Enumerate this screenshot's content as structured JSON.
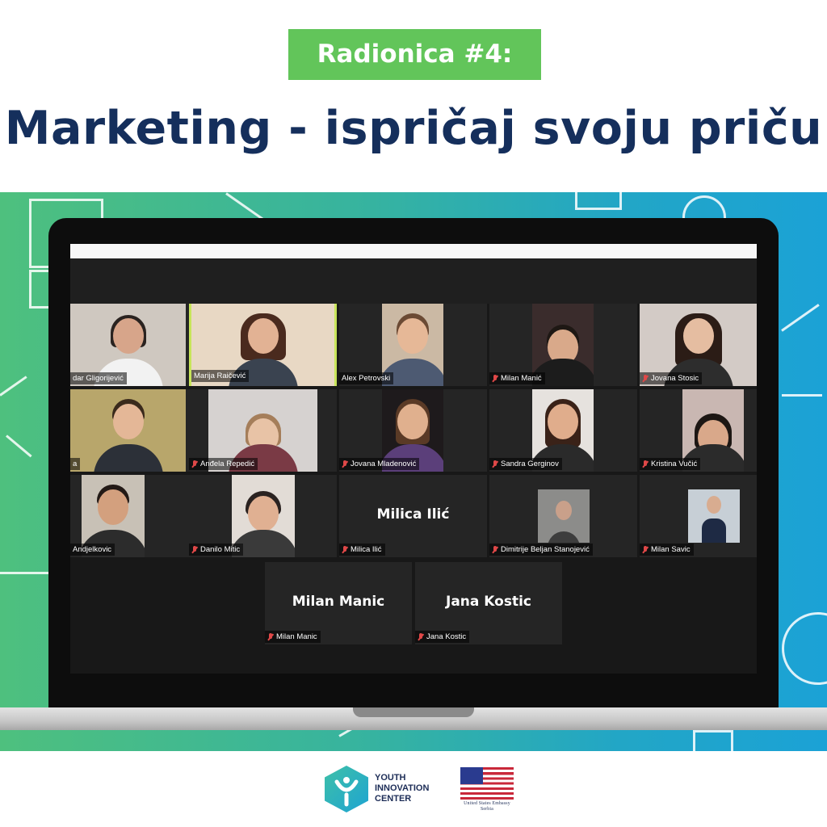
{
  "header": {
    "badge": "Radionica #4:",
    "title": "Marketing - ispričaj svoju priču"
  },
  "colors": {
    "badge_green": "#62c55a",
    "title_navy": "#152f5c",
    "band_gradient_start": "#4ec07e",
    "band_gradient_end": "#1ba2d6",
    "active_speaker_border": "#c8e55a",
    "muted_mic": "#e04848"
  },
  "participants": [
    {
      "name": "dar Gligorijević",
      "muted": false,
      "active": false,
      "video": true,
      "label_icon": "none"
    },
    {
      "name": "Marija Raičević",
      "muted": false,
      "active": true,
      "video": true,
      "label_icon": "none"
    },
    {
      "name": "Alex Petrovski",
      "muted": false,
      "active": false,
      "video": true,
      "label_icon": "none"
    },
    {
      "name": "Milan Manić",
      "muted": true,
      "active": false,
      "video": true,
      "label_icon": "mic-muted-icon"
    },
    {
      "name": "Jovana Stosic",
      "muted": true,
      "active": false,
      "video": true,
      "label_icon": "mic-muted-icon"
    },
    {
      "name": "a",
      "muted": false,
      "active": false,
      "video": true,
      "label_icon": "none"
    },
    {
      "name": "Anđela Repedić",
      "muted": true,
      "active": false,
      "video": true,
      "label_icon": "mic-muted-icon"
    },
    {
      "name": "Jovana Mladenović",
      "muted": true,
      "active": false,
      "video": true,
      "label_icon": "mic-muted-icon"
    },
    {
      "name": "Sandra Gerginov",
      "muted": true,
      "active": false,
      "video": true,
      "label_icon": "mic-muted-icon"
    },
    {
      "name": "Kristina Vučić",
      "muted": true,
      "active": false,
      "video": true,
      "label_icon": "mic-muted-icon"
    },
    {
      "name": "Andjelkovic",
      "muted": false,
      "active": false,
      "video": true,
      "label_icon": "none"
    },
    {
      "name": "Danilo Mitic",
      "muted": true,
      "active": false,
      "video": true,
      "label_icon": "mic-muted-icon"
    },
    {
      "name": "Milica Ilić",
      "muted": true,
      "active": false,
      "video": false,
      "big_name": "Milica Ilić",
      "label_icon": "mic-muted-icon"
    },
    {
      "name": "Dimitrije Beljan Stanojević",
      "muted": true,
      "active": false,
      "video": true,
      "label_icon": "mic-muted-icon"
    },
    {
      "name": "Milan Savic",
      "muted": true,
      "active": false,
      "video": true,
      "label_icon": "mic-muted-icon"
    },
    {
      "name": "Milan Manic",
      "muted": true,
      "active": false,
      "video": false,
      "big_name": "Milan Manic",
      "label_icon": "mic-muted-icon"
    },
    {
      "name": "Jana Kostic",
      "muted": true,
      "active": false,
      "video": false,
      "big_name": "Jana Kostic",
      "label_icon": "mic-muted-icon"
    }
  ],
  "footer": {
    "logo_text_line1": "YOUTH",
    "logo_text_line2": "INNOVATION",
    "logo_text_line3": "CENTER",
    "embassy_line1": "United States Embassy",
    "embassy_line2": "Serbia"
  }
}
